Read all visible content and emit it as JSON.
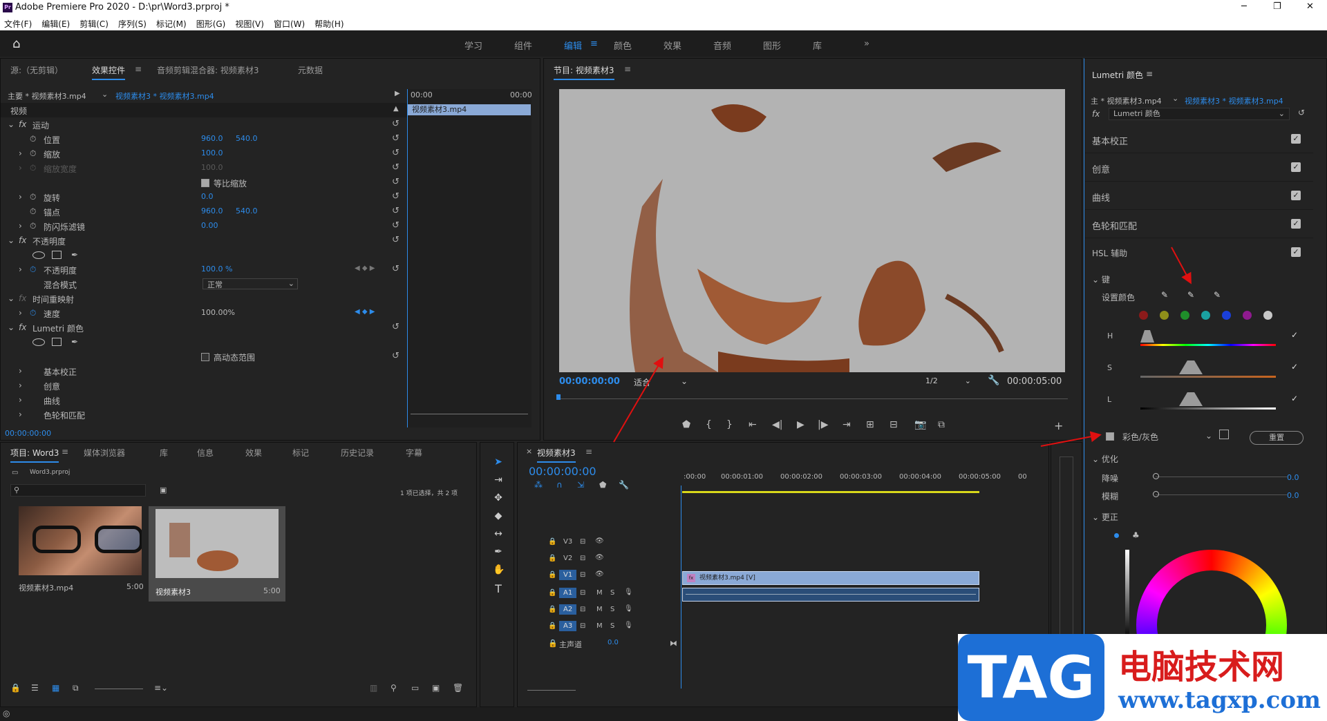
{
  "window": {
    "title": "Adobe Premiere Pro 2020 - D:\\pr\\Word3.prproj *",
    "controls": [
      "─",
      "❐",
      "✕"
    ]
  },
  "menu": [
    "文件(F)",
    "编辑(E)",
    "剪辑(C)",
    "序列(S)",
    "标记(M)",
    "图形(G)",
    "视图(V)",
    "窗口(W)",
    "帮助(H)"
  ],
  "workspaces": [
    "学习",
    "组件",
    "编辑",
    "颜色",
    "效果",
    "音频",
    "图形",
    "库"
  ],
  "active_workspace": "编辑",
  "effect_controls": {
    "tabs": [
      "源:（无剪辑）",
      "效果控件",
      "音频剪辑混合器: 视频素材3",
      "元数据"
    ],
    "master_clip": "主要 * 视频素材3.mp4",
    "sequence_clip": "视频素材3 * 视频素材3.mp4",
    "mini_timeline_start": "00:00",
    "mini_timeline_end": "00:00",
    "mini_clip": "视频素材3.mp4",
    "section_video": "视频",
    "motion": "运动",
    "position": {
      "label": "位置",
      "x": "960.0",
      "y": "540.0"
    },
    "scale": {
      "label": "缩放",
      "value": "100.0"
    },
    "scale_width": {
      "label": "缩放宽度",
      "value": "100.0"
    },
    "uniform_scale": "等比缩放",
    "rotation": {
      "label": "旋转",
      "value": "0.0"
    },
    "anchor": {
      "label": "锚点",
      "x": "960.0",
      "y": "540.0"
    },
    "anti_flicker": {
      "label": "防闪烁滤镜",
      "value": "0.00"
    },
    "opacity_section": "不透明度",
    "opacity": {
      "label": "不透明度",
      "value": "100.0 %"
    },
    "blend_mode": {
      "label": "混合模式",
      "value": "正常"
    },
    "time_remap": "时间重映射",
    "speed": {
      "label": "速度",
      "value": "100.00%"
    },
    "lumetri": "Lumetri 颜色",
    "hdr": "高动态范围",
    "sub_items": [
      "基本校正",
      "创意",
      "曲线",
      "色轮和匹配"
    ],
    "timecode": "00:00:00:00"
  },
  "program": {
    "title": "节目: 视频素材3",
    "timecode": "00:00:00:00",
    "fit": "适合",
    "resolution": "1/2",
    "duration": "00:00:05:00"
  },
  "lumetri_panel": {
    "title": "Lumetri 颜色",
    "master": "主 * 视频素材3.mp4",
    "sequence": "视频素材3 * 视频素材3.mp4",
    "effect": "Lumetri 颜色",
    "sections": [
      "基本校正",
      "创意",
      "曲线",
      "色轮和匹配",
      "HSL 辅助"
    ],
    "key": "键",
    "set_color": "设置颜色",
    "h": "H",
    "s": "S",
    "l": "L",
    "color_gray": "彩色/灰色",
    "reset": "重置",
    "refine": "优化",
    "denoise": {
      "label": "降噪",
      "value": "0.0"
    },
    "blur": {
      "label": "模糊",
      "value": "0.0"
    },
    "correction": "更正",
    "swatches": [
      "#8b1a1a",
      "#8f8f1a",
      "#1f8f2a",
      "#1aa0a0",
      "#1a3fd9",
      "#8f1a8f",
      "#c8c8c8"
    ]
  },
  "project": {
    "tabs": [
      "项目: Word3",
      "媒体浏览器",
      "库",
      "信息",
      "效果",
      "标记",
      "历史记录",
      "字幕"
    ],
    "file": "Word3.prproj",
    "selection": "1 项已选择，共 2 项",
    "items": [
      {
        "name": "视频素材3.mp4",
        "duration": "5:00"
      },
      {
        "name": "视频素材3",
        "duration": "5:00"
      }
    ]
  },
  "timeline": {
    "title": "视频素材3",
    "timecode": "00:00:00:00",
    "ruler": [
      ":00:00",
      "00:00:01:00",
      "00:00:02:00",
      "00:00:03:00",
      "00:00:04:00",
      "00:00:05:00",
      "00"
    ],
    "tracks": [
      "V3",
      "V2",
      "V1",
      "A1",
      "A2",
      "A3"
    ],
    "master": {
      "label": "主声道",
      "value": "0.0"
    },
    "clip": "视频素材3.mp4 [V]"
  },
  "watermark": {
    "tag": "TAG",
    "site_cn": "电脑技术网",
    "url": "www.tagxp.com"
  },
  "colors": {
    "accent": "#2d8ceb",
    "panel_bg": "#232323",
    "clip_blue": "#8aa9d6",
    "track_blue": "#2a5f9e"
  }
}
